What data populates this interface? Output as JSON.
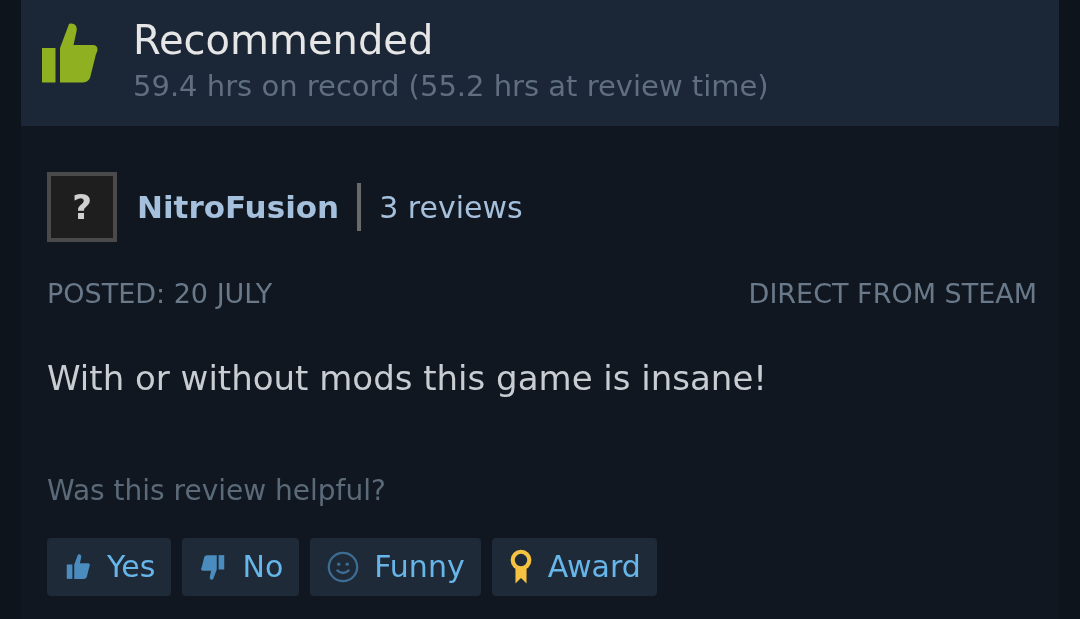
{
  "header": {
    "title": "Recommended",
    "playtime": "59.4 hrs on record (55.2 hrs at review time)"
  },
  "author": {
    "avatar": "?",
    "name": "NitroFusion",
    "reviews": "3 reviews"
  },
  "meta": {
    "posted": "POSTED: 20 JULY",
    "source": "DIRECT FROM STEAM"
  },
  "review": "With or without mods this game is insane!",
  "helpful": {
    "prompt": "Was this review helpful?",
    "buttons": [
      {
        "kind": "yes",
        "label": "Yes"
      },
      {
        "kind": "no",
        "label": "No"
      },
      {
        "kind": "funny",
        "label": "Funny"
      },
      {
        "kind": "award",
        "label": "Award"
      }
    ]
  }
}
